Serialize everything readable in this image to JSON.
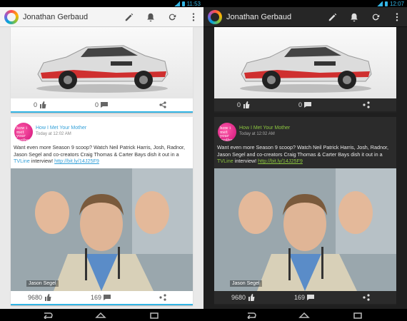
{
  "app": {
    "title": "Jonathan Gerbaud",
    "actions": [
      "pencil-icon",
      "bell-icon",
      "refresh-icon",
      "overflow-menu-icon"
    ]
  },
  "panels": {
    "light": {
      "clock": "11:53"
    },
    "dark": {
      "clock": "12:07"
    }
  },
  "card1": {
    "likes": "0",
    "comments": "0"
  },
  "card2": {
    "source": "How I Met Your Mother",
    "avatar_text": "how i met your mother",
    "time": "Today at 12:02 AM",
    "text_main": "Want even more Season 9 scoop? Watch Neil Patrick Harris, Josh, Radnor, Jason Segel and co-creators Craig Thomas & Carter Bays dish it out in a ",
    "text_link_word": "TVLine",
    "text_after": " interview! ",
    "url": "http://bit.ly/14J25F9",
    "caption": "Jason Segel",
    "likes": "9680",
    "comments": "169"
  },
  "colors": {
    "accent_light": "#33b5e5",
    "accent_dark": "#8cc63f"
  }
}
